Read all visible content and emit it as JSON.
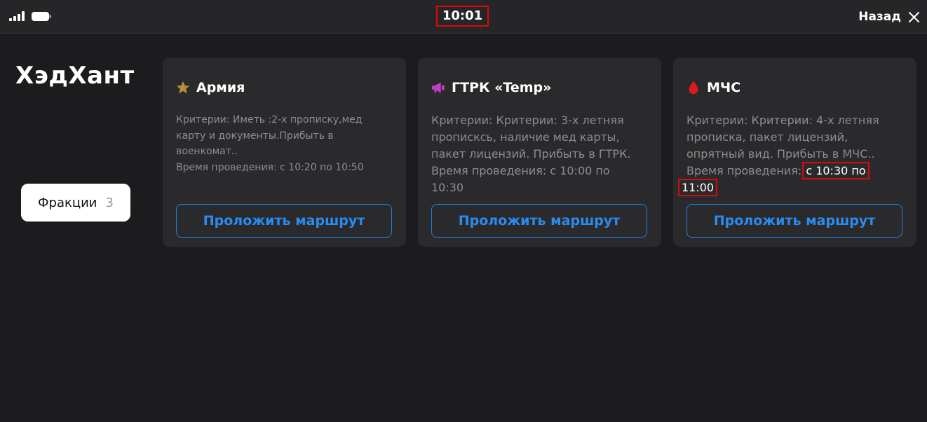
{
  "status_bar": {
    "time": "10:01",
    "back_label": "Назад",
    "icons": [
      "signal-icon",
      "battery-icon",
      "close-icon"
    ]
  },
  "sidebar": {
    "title": "ХэдХант",
    "tab": {
      "label": "Фракции",
      "count": "3"
    }
  },
  "cards": [
    {
      "icon": "star-icon",
      "title": "Армия",
      "lines": [
        "Критерии: Иметь :2-х прописку,мед",
        "карту и документы.Прибыть в",
        "военкомат..",
        "Время проведения: с 10:20 по 10:50"
      ],
      "button": "Проложить маршрут"
    },
    {
      "icon": "megaphone-icon",
      "title": "ГТРК «Temp»",
      "lines": [
        "Критерии: Критерии: 3-х летняя",
        "прописксь, наличие мед карты,",
        "пакет лицензий. Прибыть в ГТРК.",
        "Время проведения: с 10:00 по",
        "10:30"
      ],
      "button": "Проложить маршрут"
    },
    {
      "icon": "drop-icon",
      "title": "МЧС",
      "lines": [
        "Критерии: Критерии: 4-х летняя",
        "прописка, пакет лицензий,",
        "опрятный вид. Прибыть в МЧС.."
      ],
      "time_prefix": "Время проведения:",
      "time_highlight_1": "с 10:30 по",
      "time_highlight_2": "11:00",
      "button": "Проложить маршрут"
    }
  ],
  "colors": {
    "background": "#1c1c1e",
    "card": "#2a2a2c",
    "accent": "#2a8cf0",
    "highlight_border": "#d90a0a",
    "star": "#b58d3d",
    "megaphone": "#c03ec8",
    "drop": "#e01b1b"
  }
}
